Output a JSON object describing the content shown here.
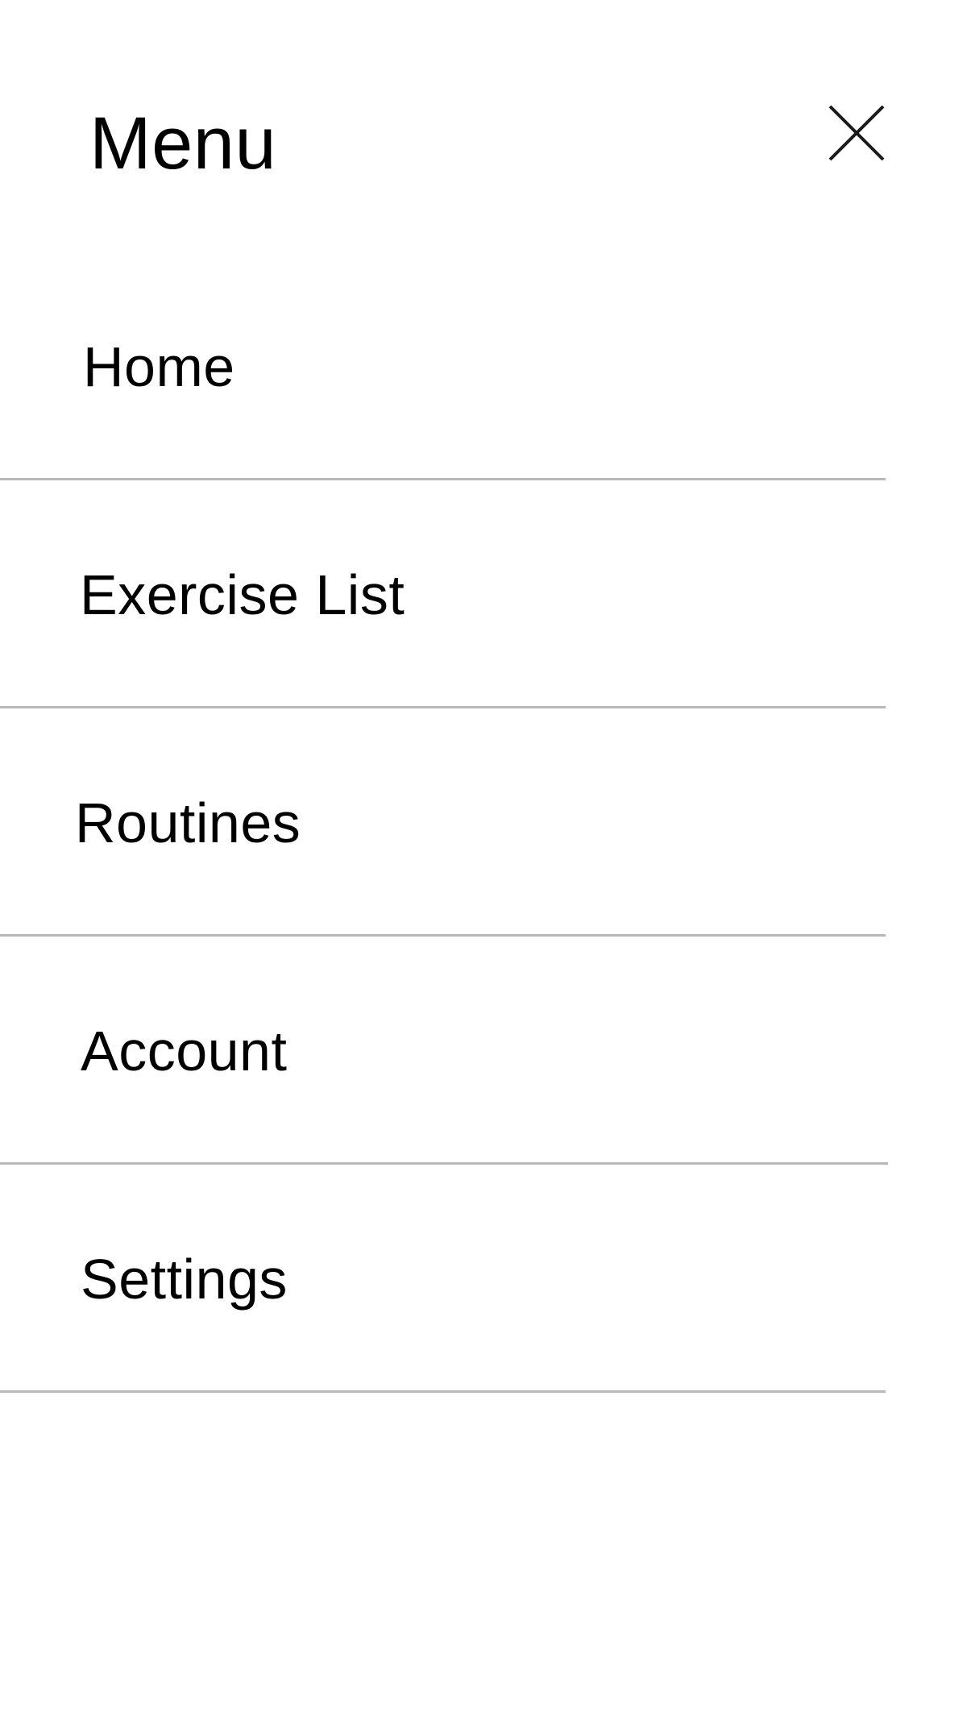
{
  "header": {
    "title": "Menu",
    "close_icon": "close-icon"
  },
  "menu": {
    "items": [
      {
        "label": "Home"
      },
      {
        "label": "Exercise List"
      },
      {
        "label": "Routines"
      },
      {
        "label": "Account"
      },
      {
        "label": "Settings"
      }
    ]
  },
  "colors": {
    "background": "#ffffff",
    "text": "#000000",
    "divider": "#b8b8b8"
  }
}
